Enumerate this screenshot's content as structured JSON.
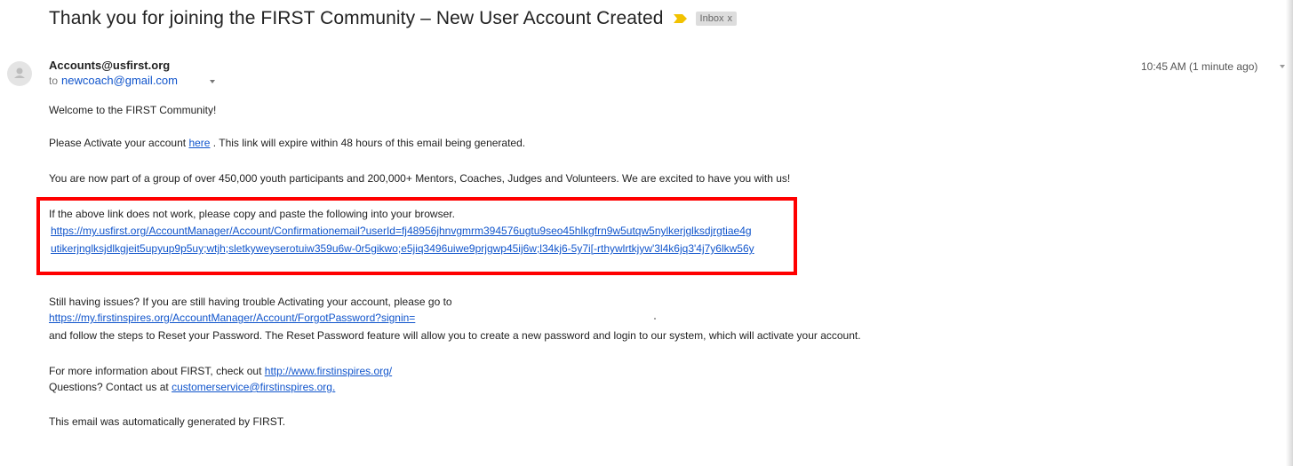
{
  "email": {
    "subject": "Thank you for joining the FIRST Community – New User Account Created",
    "label": "Inbox",
    "label_close": "x",
    "sender": "Accounts@usfirst.org",
    "to_prefix": "to",
    "to_address": "newcoach@gmail.com",
    "timestamp": "10:45 AM (1 minute ago)",
    "icons": {
      "importance": "importance-marker-icon",
      "avatar": "avatar-icon",
      "details": "chevron-down-icon"
    },
    "colors": {
      "importance": "#f2c200",
      "link": "#1155cc",
      "highlight": "#ff0000"
    }
  },
  "body": {
    "welcome": "Welcome to the FIRST Community!",
    "activate_before": "Please Activate your account ",
    "activate_link": "here",
    "activate_after": " . This link will expire within 48 hours of this email being generated.",
    "group": "You are now part of a group of over 450,000 youth participants and 200,000+ Mentors, Coaches, Judges and Volunteers. We are excited to have you with us!",
    "copy_paste": "If the above link does not work, please copy and paste the following into your browser.",
    "confirm_url_line1": "https://my.usfirst.org/AccountManager/Account/Confirmationemail?userId=fj48956jhnvgmrm394576ugtu9seo45hlkgfrn9w5utqw5nylkerjglksdjrgtiae4g",
    "confirm_url_line2": "utikerjnglksjdlkgjeit5upyup9p5uy;wtjh;sletkyweyserotuiw359u6w-0r5gikwo;e5jiq3496uiwe9prjgwp45ij6w;l34kj6-5y7i[-rthywlrtkjyw'3l4k6jq3'4j7y6lkw56y",
    "still_issues": "Still having issues? If you are still having trouble Activating your account, please go to",
    "forgot_url": "https://my.firstinspires.org/AccountManager/Account/ForgotPassword?signin=",
    "reset_steps": "and follow the steps to Reset your Password. The Reset Password feature will allow you to create a new password and login to our system, which will activate your account.",
    "more_info_prefix": "For more information about FIRST, check out ",
    "more_info_link": "http://www.firstinspires.org/",
    "questions_prefix": "Questions? Contact us at ",
    "questions_link": "customerservice@firstinspires.org.",
    "auto_generated": "This email was automatically generated by FIRST."
  }
}
